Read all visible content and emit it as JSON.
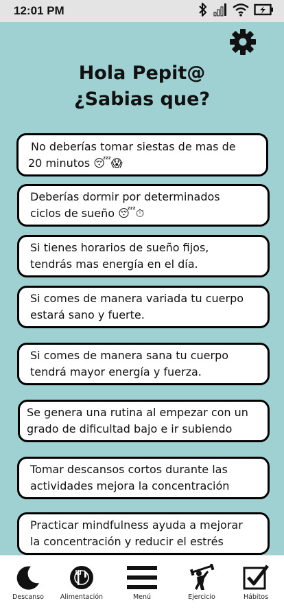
{
  "status_bar": {
    "time": "12:01 PM"
  },
  "header": {
    "greeting_line1": "Hola Pepit@",
    "greeting_line2": "¿Sabias que?"
  },
  "tips": [
    {
      "line1": "No deberías tomar siestas de mas de",
      "line2": "20 minutos 😴😱"
    },
    {
      "line1": "Deberías dormir por determinados",
      "line2": "ciclos de sueño 😴⏱"
    },
    {
      "line1": "Si tienes horarios de sueño fijos,",
      "line2": "tendrás mas energía en el día."
    },
    {
      "line1": "Si comes de manera variada tu cuerpo",
      "line2": "estará sano y fuerte."
    },
    {
      "line1": "Si comes de manera sana tu cuerpo",
      "line2": "tendrá mayor energía y fuerza."
    },
    {
      "line1": "Se genera una rutina al empezar con un",
      "line2": "grado de dificultad bajo e ir subiendo"
    },
    {
      "line1": "Tomar descansos cortos durante las",
      "line2": "actividades mejora la concentración"
    },
    {
      "line1": "Practicar mindfulness ayuda a mejorar",
      "line2": "la concentración y reducir el estrés"
    }
  ],
  "nav": [
    {
      "label": "Descanso",
      "icon": "moon-icon"
    },
    {
      "label": "Alimentación",
      "icon": "plate-cutlery-icon"
    },
    {
      "label": "Menú",
      "icon": "hamburger-menu-icon"
    },
    {
      "label": "Ejercicio",
      "icon": "weightlifter-icon"
    },
    {
      "label": "Hábitos",
      "icon": "checkbox-icon"
    }
  ]
}
